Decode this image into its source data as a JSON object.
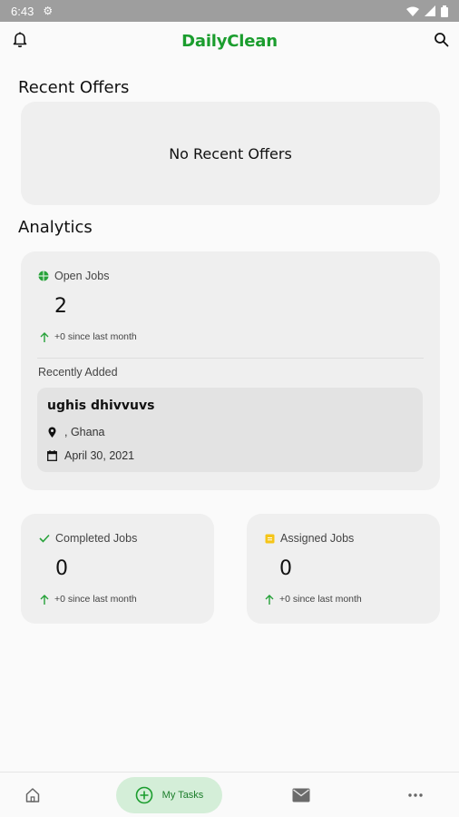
{
  "status_bar": {
    "time": "6:43"
  },
  "app_bar": {
    "title": "DailyClean"
  },
  "recent_offers": {
    "heading": "Recent Offers",
    "empty_text": "No Recent Offers"
  },
  "analytics": {
    "heading": "Analytics",
    "open_jobs": {
      "label": "Open Jobs",
      "value": "2",
      "since": "+0 since last month"
    },
    "recently_added_label": "Recently Added",
    "recent_job": {
      "title": "ughis dhivvuvs",
      "location": ", Ghana",
      "date": "April 30, 2021"
    },
    "completed_jobs": {
      "label": "Completed Jobs",
      "value": "0",
      "since": "+0 since last month"
    },
    "assigned_jobs": {
      "label": "Assigned Jobs",
      "value": "0",
      "since": "+0 since last month"
    }
  },
  "bottom_nav": {
    "tasks_label": "My Tasks"
  },
  "colors": {
    "brand": "#1b9d2e",
    "card": "#efefef",
    "nav_active": "#d4eed8",
    "assigned_icon": "#f5c518"
  }
}
